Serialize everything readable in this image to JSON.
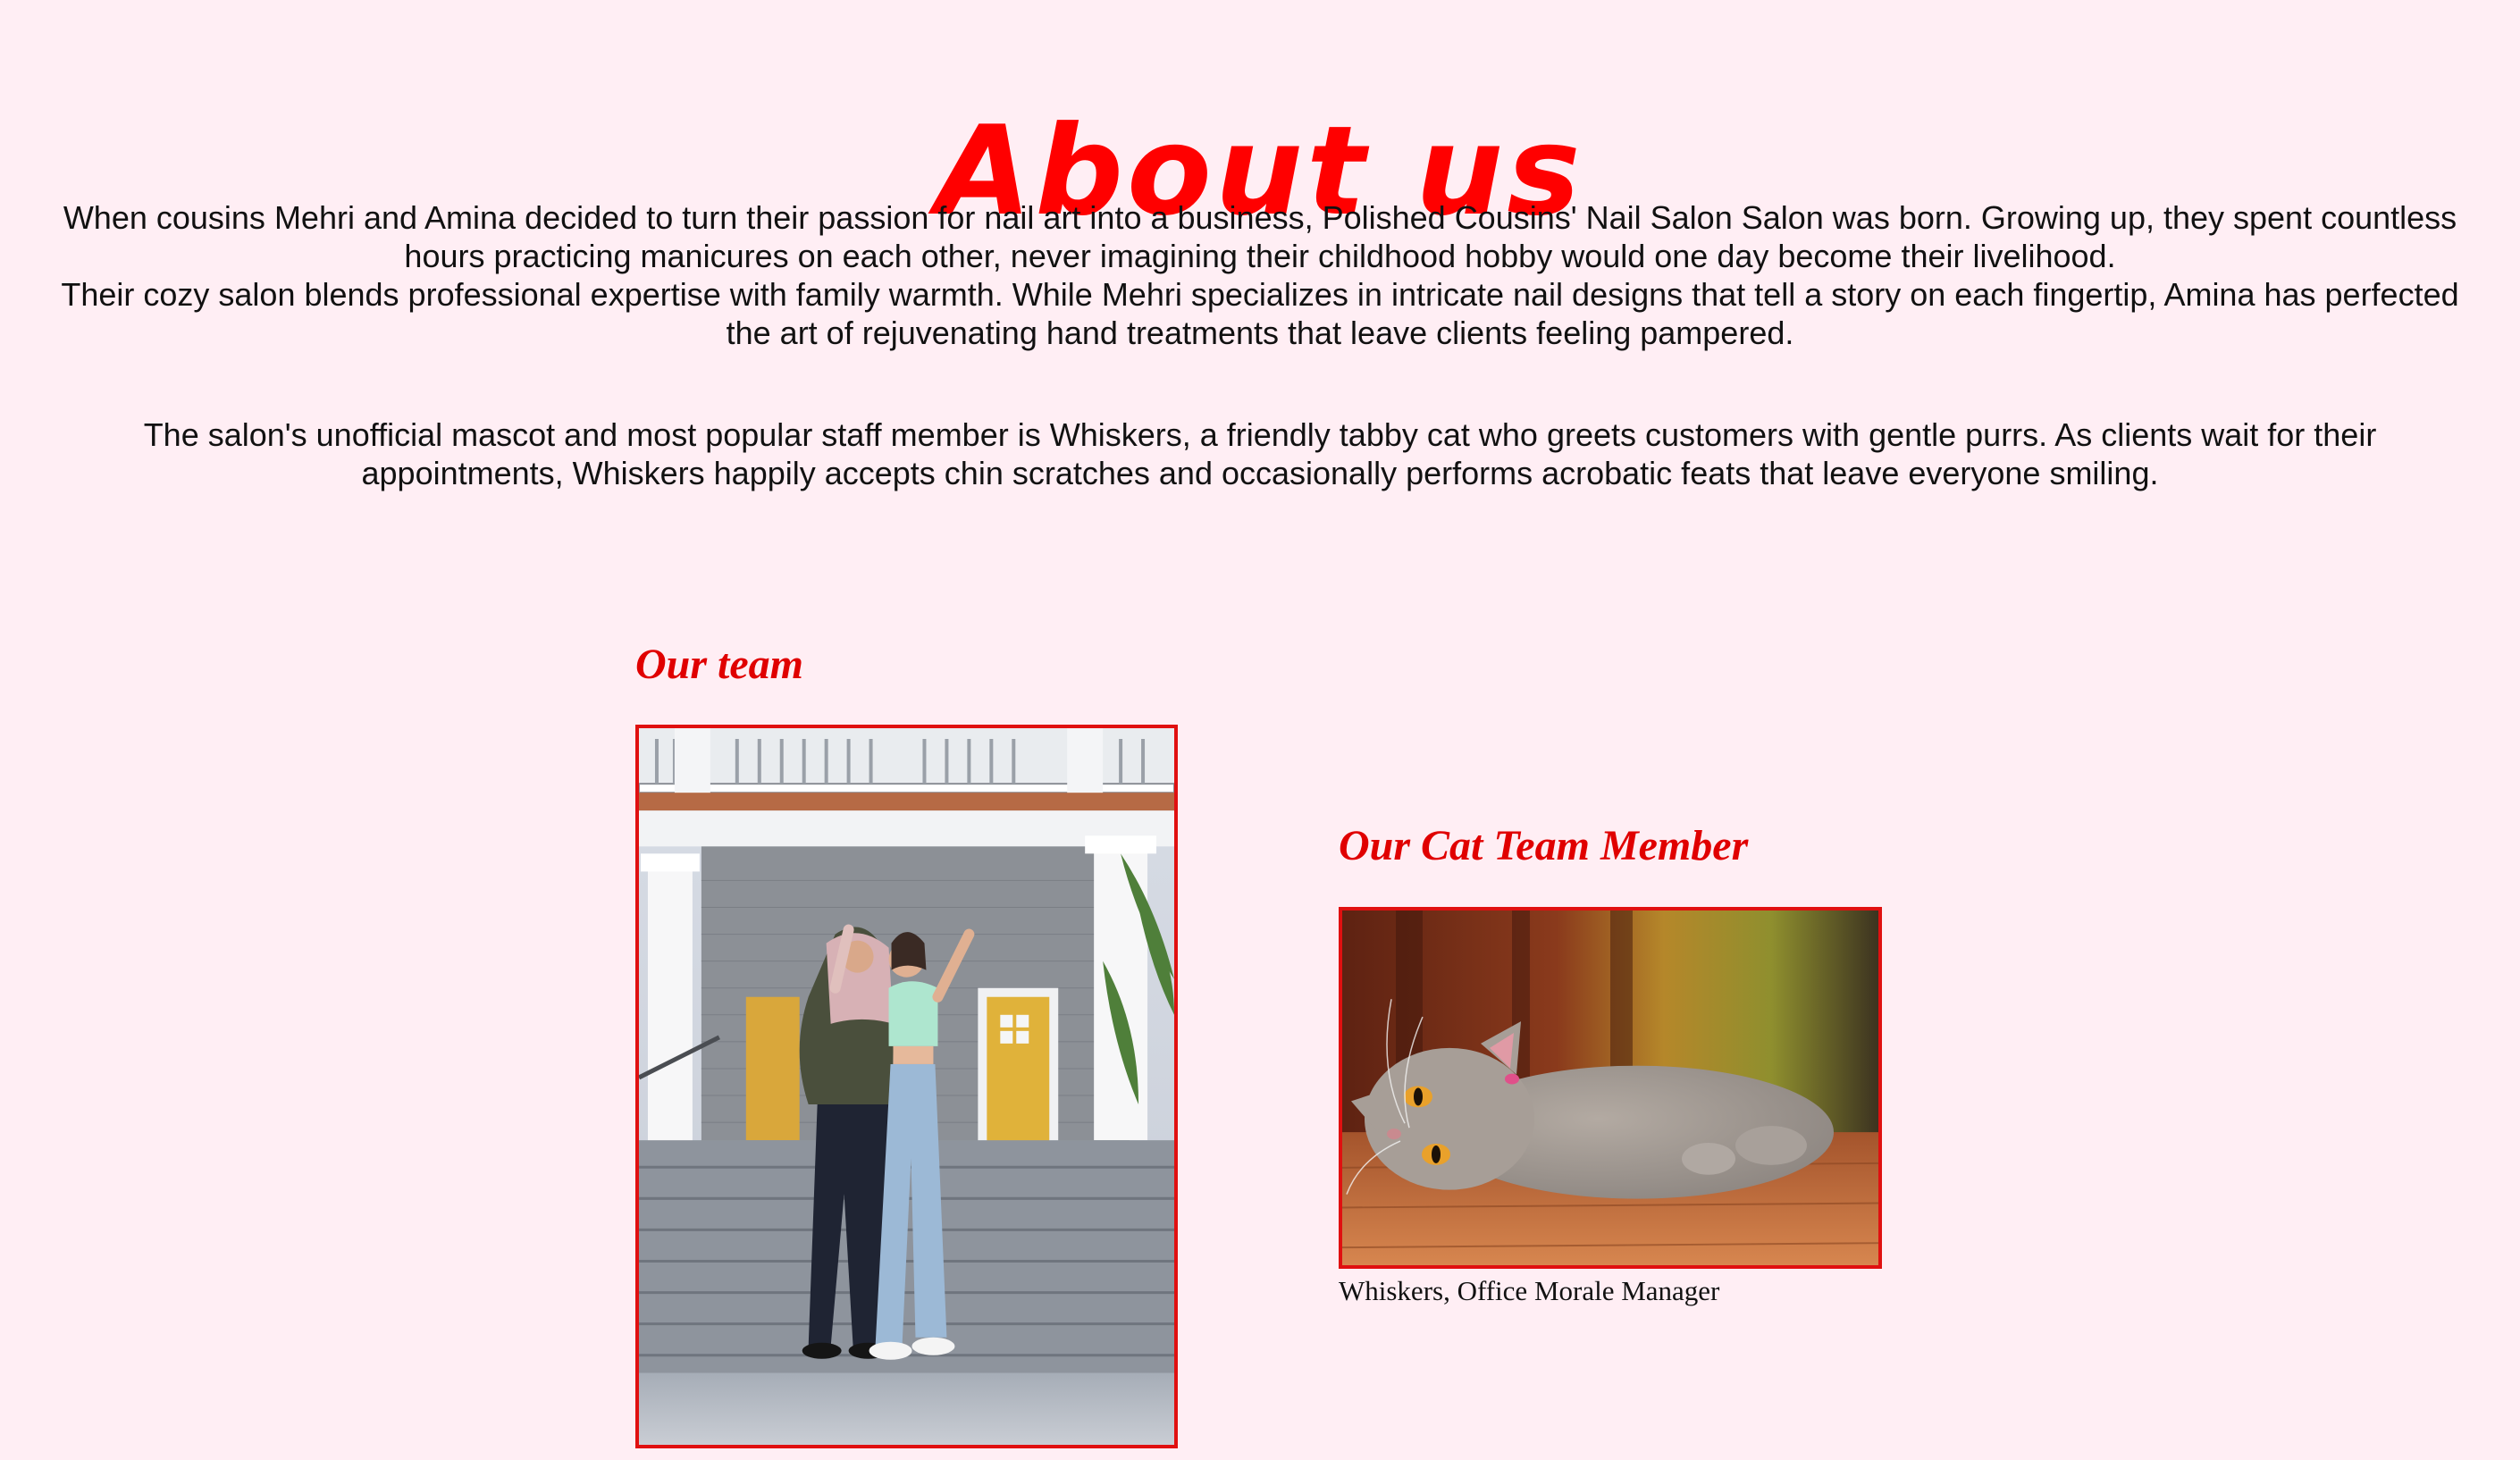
{
  "page": {
    "title": "About us"
  },
  "intro": {
    "paragraph1_line1": "When cousins Mehri and Amina decided to turn their passion for nail art into a business, Polished Cousins' Nail Salon Salon was born. Growing up, they spent countless hours practicing manicures on each other, never imagining their childhood hobby would one day become their livelihood.",
    "paragraph1_line2": "Their cozy salon blends professional expertise with family warmth. While Mehri specializes in intricate nail designs that tell a story on each fingertip, Amina has perfected the art of rejuvenating hand treatments that leave clients feeling pampered.",
    "paragraph2": "The salon's unofficial mascot and most popular staff member is Whiskers, a friendly tabby cat who greets customers with gentle purrs. As clients wait for their appointments, Whiskers happily accepts chin scratches and occasionally performs acrobatic feats that leave everyone smiling."
  },
  "team": {
    "heading": "Our team"
  },
  "cat": {
    "heading": "Our Cat Team Member",
    "caption": "Whiskers, Office Morale Manager"
  },
  "colors": {
    "background": "#ffeef4",
    "accent": "#ff0000",
    "frame_border": "#e01010"
  }
}
